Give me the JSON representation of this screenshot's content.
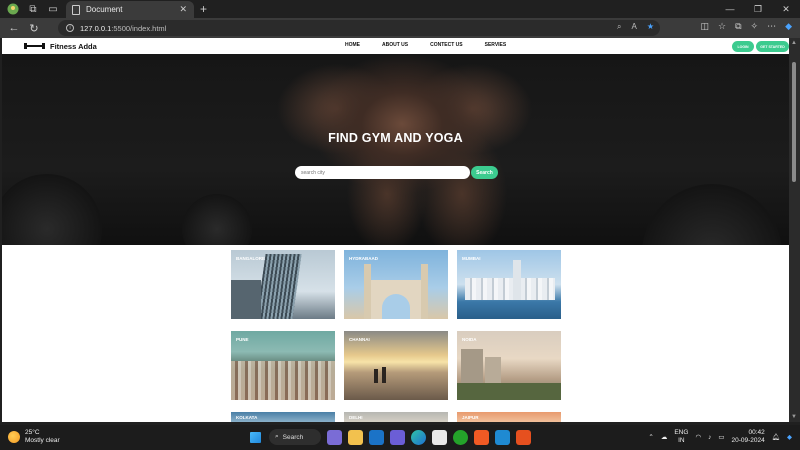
{
  "browser": {
    "tab_title": "Document",
    "url_host": "127.0.0.1",
    "url_rest": ":5500/index.html",
    "close_tab": "✕",
    "new_tab": "+",
    "window_controls": [
      "—",
      "❐",
      "✕"
    ]
  },
  "site": {
    "brand": "Fitness Adda",
    "menu": [
      "HOME",
      "ABOUT US",
      "CONTECT US",
      "SERVIES"
    ],
    "login_label": "LOGIN",
    "register_label": "GET STARTED",
    "hero_title": "FIND GYM AND YOGA",
    "search_placeholder": "search city",
    "search_button": "Search",
    "cities": [
      "BANGALORE",
      "HYDRABAAD",
      "MUMBAI",
      "PUNE",
      "CHANNAI",
      "NOIDA",
      "KOLKATA",
      "DELHI",
      "JAIPUR"
    ]
  },
  "taskbar": {
    "temperature": "25°C",
    "condition": "Mostly clear",
    "search_label": "Search",
    "lang_top": "ENG",
    "lang_bottom": "IN",
    "time": "00:42",
    "date": "20-09-2024"
  },
  "colors": {
    "accent": "#3ccb8f",
    "browser_dark": "#202020",
    "toolbar": "#3b3b3b"
  }
}
